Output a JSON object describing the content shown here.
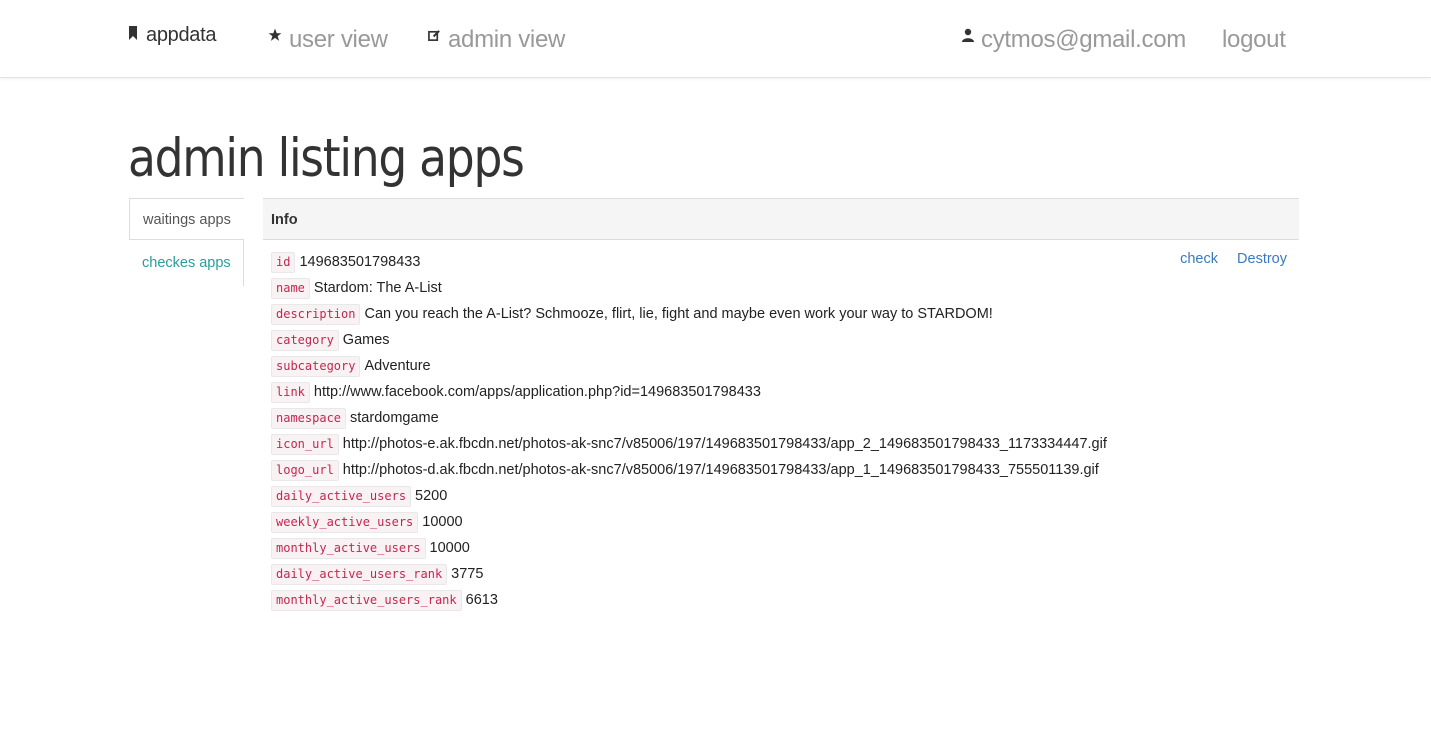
{
  "nav": {
    "brand": {
      "label": "appdata",
      "icon": "bookmark-icon"
    },
    "user_view": {
      "label": "user view",
      "icon": "star-icon"
    },
    "admin_view": {
      "label": "admin view",
      "icon": "edit-icon"
    },
    "user": {
      "label": "cytmos@gmail.com",
      "icon": "user-icon"
    },
    "logout": {
      "label": "logout"
    }
  },
  "page": {
    "title": "admin listing apps"
  },
  "tabs": [
    {
      "label": "waitings apps",
      "active": true
    },
    {
      "label": "checkes apps",
      "active": false
    }
  ],
  "panel": {
    "header": "Info",
    "actions": {
      "check": "check",
      "destroy": "Destroy"
    },
    "fields": [
      {
        "key": "id",
        "value": "149683501798433"
      },
      {
        "key": "name",
        "value": "Stardom: The A-List"
      },
      {
        "key": "description",
        "value": "Can you reach the A-List? Schmooze, flirt, lie, fight and maybe even work your way to STARDOM!"
      },
      {
        "key": "category",
        "value": "Games"
      },
      {
        "key": "subcategory",
        "value": "Adventure"
      },
      {
        "key": "link",
        "value": "http://www.facebook.com/apps/application.php?id=149683501798433"
      },
      {
        "key": "namespace",
        "value": "stardomgame"
      },
      {
        "key": "icon_url",
        "value": "http://photos-e.ak.fbcdn.net/photos-ak-snc7/v85006/197/149683501798433/app_2_149683501798433_1173334447.gif"
      },
      {
        "key": "logo_url",
        "value": "http://photos-d.ak.fbcdn.net/photos-ak-snc7/v85006/197/149683501798433/app_1_149683501798433_755501139.gif"
      },
      {
        "key": "daily_active_users",
        "value": "5200"
      },
      {
        "key": "weekly_active_users",
        "value": "10000"
      },
      {
        "key": "monthly_active_users",
        "value": "10000"
      },
      {
        "key": "daily_active_users_rank",
        "value": "3775"
      },
      {
        "key": "monthly_active_users_rank",
        "value": "6613"
      }
    ]
  },
  "colors": {
    "link_blue": "#3a7bbf",
    "tab_teal": "#2a9d9b",
    "code_red": "#c7254e",
    "nav_gray": "#999999"
  }
}
